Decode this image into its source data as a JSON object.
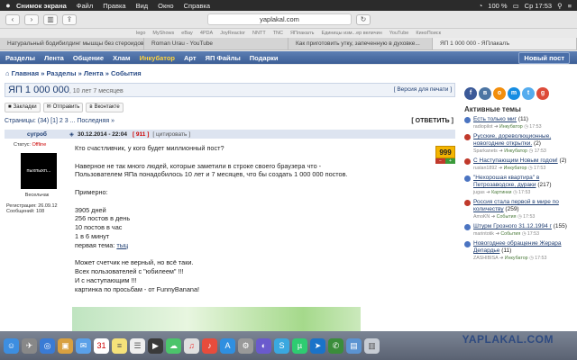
{
  "menubar": {
    "apple": "",
    "items": [
      "Снимок экрана",
      "Файл",
      "Правка",
      "Вид",
      "Окно",
      "Справка"
    ],
    "battery": "100 %",
    "time": "Ср 17:53"
  },
  "browser": {
    "url": "yaplakal.com",
    "bookmarks": [
      "lego",
      "MyShows",
      "eBay",
      "4PDA",
      "JoyReactor",
      "NNTT",
      "TNC",
      "ЯПлакалъ",
      "Единицы изм...ер величин",
      "YouTube",
      "КиноПоиск"
    ],
    "tabs": [
      "Натуральный бодибилдинг мышцы без стероидов",
      "Roman Urau - YouTube",
      "Как приготовить утку, запеченную в духовке...",
      "ЯП 1 000 000 - ЯПлакалъ"
    ]
  },
  "nav": {
    "items": [
      "Разделы",
      "Лента",
      "Общение",
      "Хлам",
      "Инкубатор",
      "Арт",
      "ЯП Файлы",
      "Подарки"
    ],
    "new_post": "Новый пост"
  },
  "breadcrumb": [
    "Главная",
    "Разделы",
    "Лента",
    "События"
  ],
  "topic": {
    "title": "ЯП 1 000 000",
    "age": ", 10 лет 7 месяцев",
    "print_version": "[ Версия для печати ]",
    "share": [
      "Закладки",
      "Отправить",
      "Вконтакте"
    ],
    "pages_label": "Страницы: (34) [1] 2 3 ...",
    "last": "Последняя »",
    "reply": "[ ОТВЕТИТЬ ]"
  },
  "post": {
    "author": "сугроб",
    "date": "30.12.2014 - 22:04",
    "number": "[ 911 ]",
    "quote": "[ цитировать ]",
    "status_label": "Статус:",
    "status": "Offline",
    "avatar_text": "пыхпыхп...",
    "rank": "Весельчак",
    "registered": "Регистрация: 26.09.12",
    "messages": "Сообщений: 108",
    "rating": "999",
    "minus": "−",
    "plus": "+",
    "lines": [
      "Кто счастливчик, у кого будет миллионный пост?",
      "",
      "Наверное не так много людей, которые заметили в строке своего браузера что -",
      "Пользователем ЯПа понадобилось 10 лет и 7 месяцев, что бы создать 1 000 000 постов.",
      "",
      "Примерно:",
      "",
      "3905 дней",
      "256 постов в день",
      "10 постов в час",
      "1 в 6 минут",
      "первая тема:",
      "",
      "Может счетчик не верный, но всё таки.",
      "Всех пользователей с \"юбилеем\" !!!",
      "И с наступающим !!!",
      "картинка по просьбам - от FunnyBanana!"
    ],
    "first_topic_link": "тыц"
  },
  "sidebar": {
    "social": [
      "f",
      "в",
      "o",
      "m",
      "t",
      "g"
    ],
    "heading": "Активные темы",
    "topics": [
      {
        "title": "Есть только миг",
        "count": "(11)",
        "user": "radiopilot",
        "section": "Инкубатор",
        "time": "17:53"
      },
      {
        "title": "Русские, дореволюционные, новогодние открытки.",
        "count": "(2)",
        "user": "Sparkanets",
        "section": "Инкубатор",
        "time": "17:53"
      },
      {
        "title": "С Наступающим Новым годом!",
        "count": "(2)",
        "user": "ruslan1892",
        "section": "Инкубатор",
        "time": "17:53"
      },
      {
        "title": "\"Нехорошая квартира\" в Петрозаводске, дураки",
        "count": "(217)",
        "user": "jugas",
        "section": "Картинки",
        "time": "17:53"
      },
      {
        "title": "Россия стала первой в мире по количеству",
        "count": "(259)",
        "user": "AmoKN",
        "section": "События",
        "time": "17:53"
      },
      {
        "title": "Штурм Грозного 31.12.1994 г",
        "count": "(155)",
        "user": "marintotik",
        "section": "События",
        "time": "17:53"
      },
      {
        "title": "Новогоднее обращение Жерара Депардье",
        "count": "(11)",
        "user": "ZASHIBISA",
        "section": "Инкубатор",
        "time": "17:53"
      }
    ]
  },
  "dock": {
    "brand": "YAPLAKAL.COM",
    "icons": [
      "finder-icon",
      "launchpad-icon",
      "safari-icon",
      "photos-icon",
      "mail-icon",
      "calendar-icon",
      "notes-icon",
      "reminders-icon",
      "facetime-icon",
      "messages-icon",
      "itunes-icon",
      "appstore-icon",
      "settings-icon",
      "torrent-icon",
      "skype-icon",
      "utorrent-icon",
      "viber-icon",
      "folder-icon",
      "trash-icon"
    ]
  }
}
